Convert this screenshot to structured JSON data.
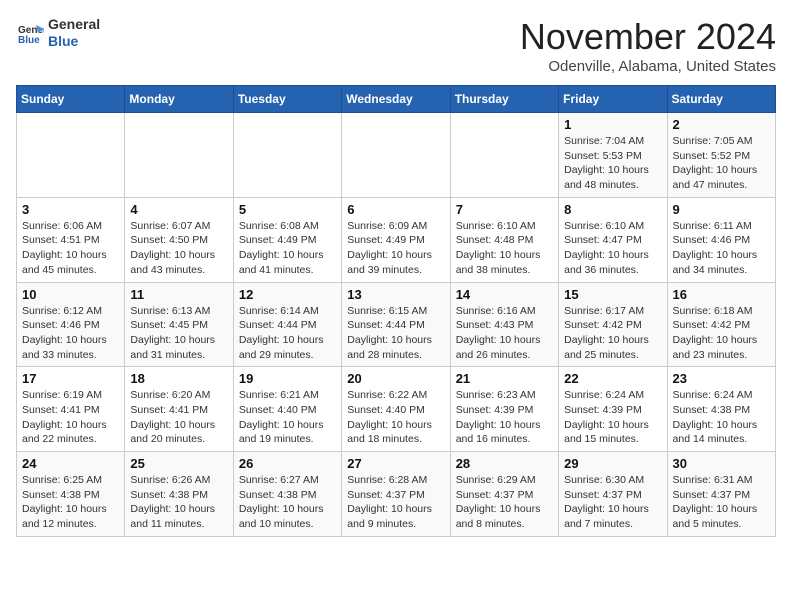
{
  "header": {
    "logo_general": "General",
    "logo_blue": "Blue",
    "month": "November 2024",
    "location": "Odenville, Alabama, United States"
  },
  "weekdays": [
    "Sunday",
    "Monday",
    "Tuesday",
    "Wednesday",
    "Thursday",
    "Friday",
    "Saturday"
  ],
  "weeks": [
    [
      {
        "day": "",
        "info": ""
      },
      {
        "day": "",
        "info": ""
      },
      {
        "day": "",
        "info": ""
      },
      {
        "day": "",
        "info": ""
      },
      {
        "day": "",
        "info": ""
      },
      {
        "day": "1",
        "info": "Sunrise: 7:04 AM\nSunset: 5:53 PM\nDaylight: 10 hours\nand 48 minutes."
      },
      {
        "day": "2",
        "info": "Sunrise: 7:05 AM\nSunset: 5:52 PM\nDaylight: 10 hours\nand 47 minutes."
      }
    ],
    [
      {
        "day": "3",
        "info": "Sunrise: 6:06 AM\nSunset: 4:51 PM\nDaylight: 10 hours\nand 45 minutes."
      },
      {
        "day": "4",
        "info": "Sunrise: 6:07 AM\nSunset: 4:50 PM\nDaylight: 10 hours\nand 43 minutes."
      },
      {
        "day": "5",
        "info": "Sunrise: 6:08 AM\nSunset: 4:49 PM\nDaylight: 10 hours\nand 41 minutes."
      },
      {
        "day": "6",
        "info": "Sunrise: 6:09 AM\nSunset: 4:49 PM\nDaylight: 10 hours\nand 39 minutes."
      },
      {
        "day": "7",
        "info": "Sunrise: 6:10 AM\nSunset: 4:48 PM\nDaylight: 10 hours\nand 38 minutes."
      },
      {
        "day": "8",
        "info": "Sunrise: 6:10 AM\nSunset: 4:47 PM\nDaylight: 10 hours\nand 36 minutes."
      },
      {
        "day": "9",
        "info": "Sunrise: 6:11 AM\nSunset: 4:46 PM\nDaylight: 10 hours\nand 34 minutes."
      }
    ],
    [
      {
        "day": "10",
        "info": "Sunrise: 6:12 AM\nSunset: 4:46 PM\nDaylight: 10 hours\nand 33 minutes."
      },
      {
        "day": "11",
        "info": "Sunrise: 6:13 AM\nSunset: 4:45 PM\nDaylight: 10 hours\nand 31 minutes."
      },
      {
        "day": "12",
        "info": "Sunrise: 6:14 AM\nSunset: 4:44 PM\nDaylight: 10 hours\nand 29 minutes."
      },
      {
        "day": "13",
        "info": "Sunrise: 6:15 AM\nSunset: 4:44 PM\nDaylight: 10 hours\nand 28 minutes."
      },
      {
        "day": "14",
        "info": "Sunrise: 6:16 AM\nSunset: 4:43 PM\nDaylight: 10 hours\nand 26 minutes."
      },
      {
        "day": "15",
        "info": "Sunrise: 6:17 AM\nSunset: 4:42 PM\nDaylight: 10 hours\nand 25 minutes."
      },
      {
        "day": "16",
        "info": "Sunrise: 6:18 AM\nSunset: 4:42 PM\nDaylight: 10 hours\nand 23 minutes."
      }
    ],
    [
      {
        "day": "17",
        "info": "Sunrise: 6:19 AM\nSunset: 4:41 PM\nDaylight: 10 hours\nand 22 minutes."
      },
      {
        "day": "18",
        "info": "Sunrise: 6:20 AM\nSunset: 4:41 PM\nDaylight: 10 hours\nand 20 minutes."
      },
      {
        "day": "19",
        "info": "Sunrise: 6:21 AM\nSunset: 4:40 PM\nDaylight: 10 hours\nand 19 minutes."
      },
      {
        "day": "20",
        "info": "Sunrise: 6:22 AM\nSunset: 4:40 PM\nDaylight: 10 hours\nand 18 minutes."
      },
      {
        "day": "21",
        "info": "Sunrise: 6:23 AM\nSunset: 4:39 PM\nDaylight: 10 hours\nand 16 minutes."
      },
      {
        "day": "22",
        "info": "Sunrise: 6:24 AM\nSunset: 4:39 PM\nDaylight: 10 hours\nand 15 minutes."
      },
      {
        "day": "23",
        "info": "Sunrise: 6:24 AM\nSunset: 4:38 PM\nDaylight: 10 hours\nand 14 minutes."
      }
    ],
    [
      {
        "day": "24",
        "info": "Sunrise: 6:25 AM\nSunset: 4:38 PM\nDaylight: 10 hours\nand 12 minutes."
      },
      {
        "day": "25",
        "info": "Sunrise: 6:26 AM\nSunset: 4:38 PM\nDaylight: 10 hours\nand 11 minutes."
      },
      {
        "day": "26",
        "info": "Sunrise: 6:27 AM\nSunset: 4:38 PM\nDaylight: 10 hours\nand 10 minutes."
      },
      {
        "day": "27",
        "info": "Sunrise: 6:28 AM\nSunset: 4:37 PM\nDaylight: 10 hours\nand 9 minutes."
      },
      {
        "day": "28",
        "info": "Sunrise: 6:29 AM\nSunset: 4:37 PM\nDaylight: 10 hours\nand 8 minutes."
      },
      {
        "day": "29",
        "info": "Sunrise: 6:30 AM\nSunset: 4:37 PM\nDaylight: 10 hours\nand 7 minutes."
      },
      {
        "day": "30",
        "info": "Sunrise: 6:31 AM\nSunset: 4:37 PM\nDaylight: 10 hours\nand 5 minutes."
      }
    ]
  ]
}
